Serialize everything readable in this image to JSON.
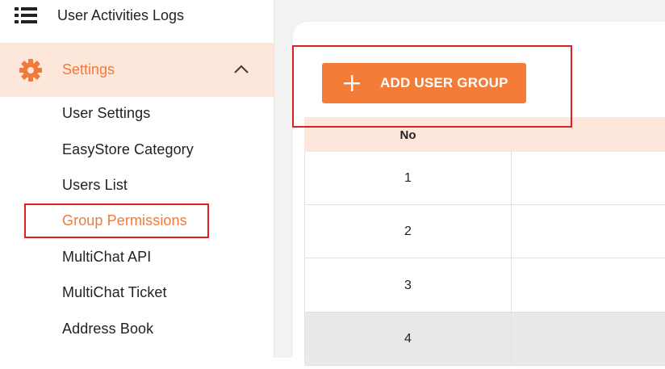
{
  "sidebar": {
    "top_item_label": "User Activities Logs",
    "settings_label": "Settings",
    "sub_items": [
      {
        "label": "User Settings"
      },
      {
        "label": "EasyStore Category"
      },
      {
        "label": "Users List"
      },
      {
        "label": "Group Permissions"
      },
      {
        "label": "MultiChat API"
      },
      {
        "label": "MultiChat Ticket"
      },
      {
        "label": "Address Book"
      }
    ]
  },
  "main": {
    "add_button_label": "ADD USER GROUP",
    "table": {
      "header_no": "No",
      "rows": [
        {
          "no": "1"
        },
        {
          "no": "2"
        },
        {
          "no": "3"
        },
        {
          "no": "4"
        }
      ]
    }
  },
  "colors": {
    "accent": "#f47c37",
    "accent_light": "#fde6da",
    "highlight": "#e02020"
  },
  "icons": [
    "list-icon",
    "gear-icon",
    "chevron-up-icon",
    "plus-icon"
  ]
}
